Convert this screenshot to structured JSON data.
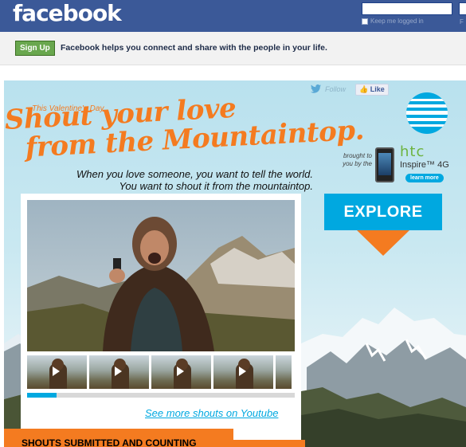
{
  "header": {
    "logo": "facebook",
    "keep_logged_in": "Keep me logged in",
    "forgot_fragment": "F"
  },
  "signup_bar": {
    "signup_label": "Sign Up",
    "tagline": "Facebook helps you connect and share with the people in your life."
  },
  "campaign": {
    "follow_label": "Follow",
    "like_label": "Like",
    "eyebrow": "This Valentine's Day",
    "headline_line1": "Shout your love",
    "headline_line2": "from the Mountaintop.",
    "subline_1": "When you love someone, you want to tell the world.",
    "subline_2": "You want to shout it from the mountaintop.",
    "brought_by": "brought to you by the",
    "htc": "htc",
    "inspire": "Inspire™ 4G",
    "learn_more": "learn more",
    "explore": "EXPLORE",
    "see_more": "See more shouts on Youtube",
    "video_progress": 0.11,
    "shouts_banner": "SHOUTS SUBMITTED AND COUNTING"
  },
  "colors": {
    "facebook_blue": "#3b5998",
    "campaign_orange": "#f47b20",
    "att_blue": "#00a8e0",
    "htc_green": "#6db33f"
  },
  "icons": [
    "twitter-bird-icon",
    "facebook-like-icon",
    "att-globe-icon",
    "play-icon",
    "down-arrow-icon"
  ]
}
